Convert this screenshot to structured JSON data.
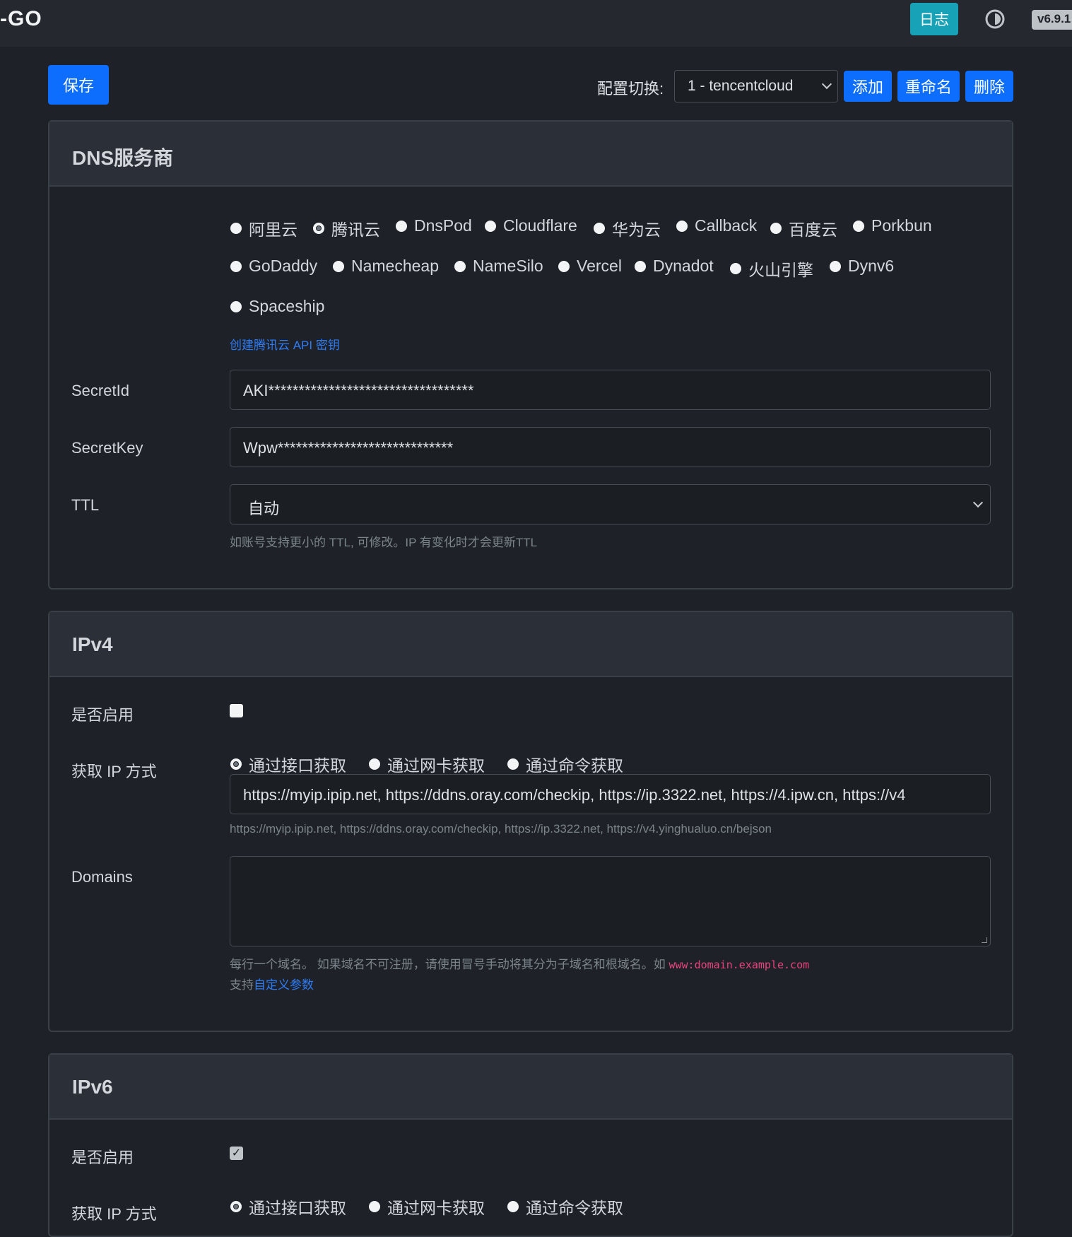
{
  "app": {
    "brand": "-GO",
    "version": "v6.9.1"
  },
  "topbar": {
    "log_label": "日志"
  },
  "toolbar": {
    "save_label": "保存",
    "config_label": "配置切换:",
    "config_selected": "1 - tencentcloud",
    "add_label": "添加",
    "rename_label": "重命名",
    "delete_label": "删除"
  },
  "dns": {
    "title": "DNS服务商",
    "providers": [
      "阿里云",
      "腾讯云",
      "DnsPod",
      "Cloudflare",
      "华为云",
      "Callback",
      "百度云",
      "Porkbun",
      "GoDaddy",
      "Namecheap",
      "NameSilo",
      "Vercel",
      "Dynadot",
      "火山引擎",
      "Dynv6",
      "Spaceship"
    ],
    "selected_provider": "腾讯云",
    "api_link": "创建腾讯云 API 密钥",
    "secret_id_label": "SecretId",
    "secret_id_value": "AKI**********************************",
    "secret_key_label": "SecretKey",
    "secret_key_value": "Wpw*****************************",
    "ttl_label": "TTL",
    "ttl_value": "自动",
    "ttl_help": "如账号支持更小的 TTL, 可修改。IP 有变化时才会更新TTL"
  },
  "ipv4": {
    "title": "IPv4",
    "enable_label": "是否启用",
    "enabled": false,
    "method_label": "获取 IP 方式",
    "methods": [
      "通过接口获取",
      "通过网卡获取",
      "通过命令获取"
    ],
    "selected_method": "通过接口获取",
    "url_value": "https://myip.ipip.net, https://ddns.oray.com/checkip, https://ip.3322.net, https://4.ipw.cn, https://v4",
    "url_help": "https://myip.ipip.net, https://ddns.oray.com/checkip, https://ip.3322.net, https://v4.yinghualuo.cn/bejson",
    "domains_label": "Domains",
    "domains_help_prefix": "每行一个域名。 如果域名不可注册，请使用冒号手动将其分为子域名和根域名。如 ",
    "domains_help_code": "www:domain.example.com",
    "custom_prefix": "支持",
    "custom_link": "自定义参数"
  },
  "ipv6": {
    "title": "IPv6",
    "enable_label": "是否启用",
    "enabled": true,
    "method_label": "获取 IP 方式",
    "methods": [
      "通过接口获取",
      "通过网卡获取",
      "通过命令获取"
    ],
    "selected_method": "通过接口获取"
  },
  "colors": {
    "primary": "#0d6efd",
    "info": "#17a2b8",
    "background": "#1e2228",
    "link": "#2f7cf6",
    "code": "#e8447d"
  }
}
